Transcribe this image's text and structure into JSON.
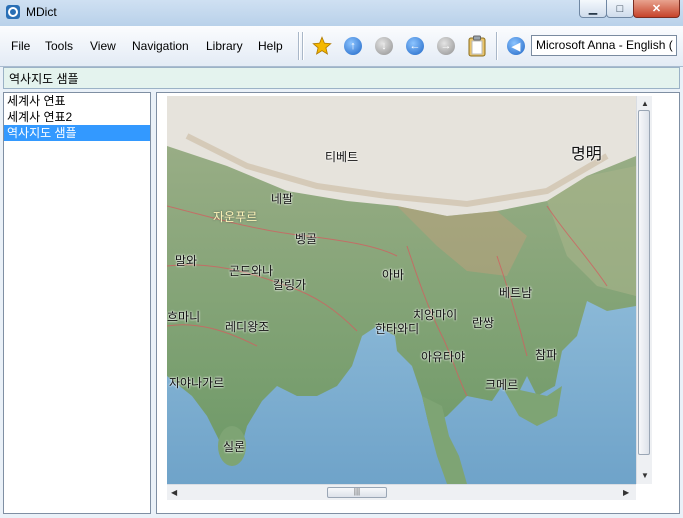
{
  "window": {
    "title": "MDict",
    "minimize_glyph": "▁",
    "maximize_glyph": "□",
    "close_glyph": "✕"
  },
  "menu": [
    "File",
    "Tools",
    "View",
    "Navigation",
    "Library",
    "Help"
  ],
  "toolbar": {
    "icons": [
      "star-icon",
      "arrow-up-icon",
      "arrow-down-icon",
      "arrow-left-icon",
      "arrow-right-icon",
      "clipboard-icon",
      "speaker-icon"
    ],
    "voice_value": "Microsoft Anna - English ("
  },
  "entry": {
    "current": "역사지도 샘플"
  },
  "list": {
    "items": [
      {
        "label": "세계사 연표",
        "selected": false
      },
      {
        "label": "세계사 연표2",
        "selected": false
      },
      {
        "label": "역사지도 샘플",
        "selected": true
      }
    ]
  },
  "map": {
    "labels": {
      "tibet": "티베트",
      "ming": "명明",
      "nepal": "네팔",
      "jaunpur": "자운푸르",
      "bengal": "벵골",
      "malwa": "말와",
      "gondwana": "곤드와나",
      "kalinga": "칼링가",
      "ava": "아바",
      "vietnam": "베트남",
      "bahmani": "흐마니",
      "reddi": "레디왕조",
      "hanthawaddy": "한타와디",
      "chiangmai": "치앙마이",
      "lanxang": "란쌍",
      "ayutthaya": "아유타야",
      "champa": "참파",
      "vijayanagara": "자야나가르",
      "khmer": "크메르",
      "ceylon": "실론"
    }
  },
  "colors": {
    "selection": "#3399ff",
    "entry_bar": "#e4f3ee",
    "sea": "#9cc7e0",
    "land": "#7fa57a"
  }
}
